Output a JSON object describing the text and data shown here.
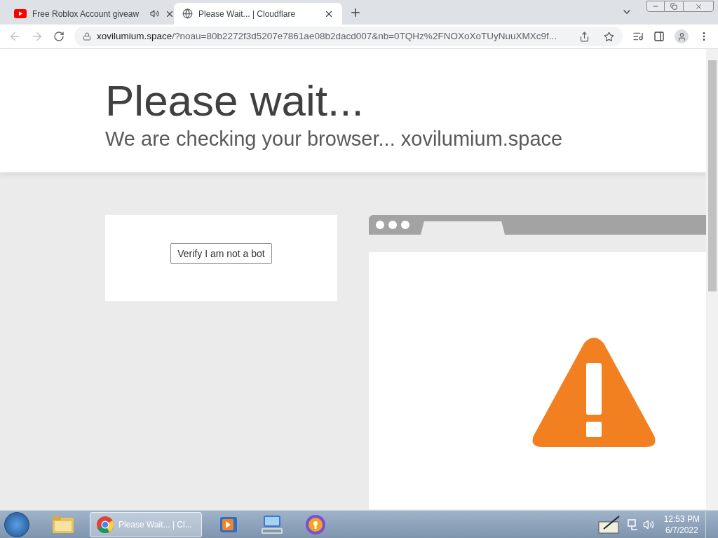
{
  "browser": {
    "tabs": [
      {
        "title": "Free Roblox Account giveaw",
        "selected": false,
        "audio": true,
        "kind": "youtube"
      },
      {
        "title": "Please Wait... | Cloudflare",
        "selected": true,
        "audio": false,
        "kind": "globe"
      }
    ],
    "address": {
      "host": "xovilumium.space",
      "path": "/?noau=80b2272f3d5207e7861ae08b2dacd007&nb=0TQHz%2FNOXoXoTUyNuuXMXc9f..."
    }
  },
  "page": {
    "heading": "Please wait...",
    "subheading": "We are checking your browser... xovilumium.space",
    "verify_button": "Verify I am not a bot"
  },
  "taskbar": {
    "apps": [
      {
        "kind": "folder",
        "selected": false
      },
      {
        "kind": "chrome",
        "label": "Please Wait... | Cl...",
        "selected": true
      },
      {
        "kind": "media",
        "selected": false
      },
      {
        "kind": "keyboard",
        "selected": false
      },
      {
        "kind": "shield",
        "selected": false
      }
    ],
    "time": "12:53 PM",
    "date": "6/7/2022"
  }
}
